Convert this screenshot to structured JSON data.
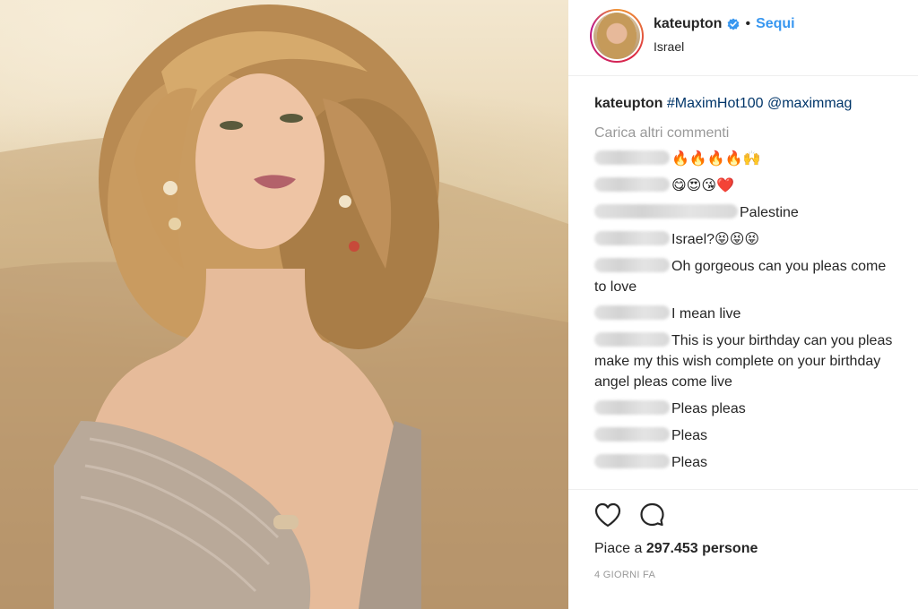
{
  "post": {
    "image_alt": "photo",
    "username": "kateupton",
    "follow_label": "Sequi",
    "dot": "•",
    "location": "Israel"
  },
  "caption": {
    "username": "kateupton",
    "hashtag": "#MaximHot100",
    "mention": "@maximmag"
  },
  "load_more": "Carica altri commenti",
  "comments": [
    {
      "text": "🔥🔥🔥🔥🙌"
    },
    {
      "text": "😋😍😘❤️"
    },
    {
      "text": "Palestine"
    },
    {
      "text": "Israel?😝😝😝"
    },
    {
      "text": "Oh gorgeous can you pleas come to love"
    },
    {
      "text": "I mean live"
    },
    {
      "text": "This is your birthday can you pleas make my this wish complete on your birthday angel pleas come live"
    },
    {
      "text": "Pleas pleas"
    },
    {
      "text": "Pleas"
    },
    {
      "text": "Pleas"
    }
  ],
  "likes": {
    "prefix": "Piace a",
    "count": "297.453",
    "suffix": "persone"
  },
  "timestamp": "4 GIORNI FA",
  "colors": {
    "link": "#3897f0",
    "hashtag": "#003569",
    "muted": "#999999"
  },
  "icons": [
    "verified-badge-icon",
    "heart-icon",
    "comment-icon"
  ]
}
